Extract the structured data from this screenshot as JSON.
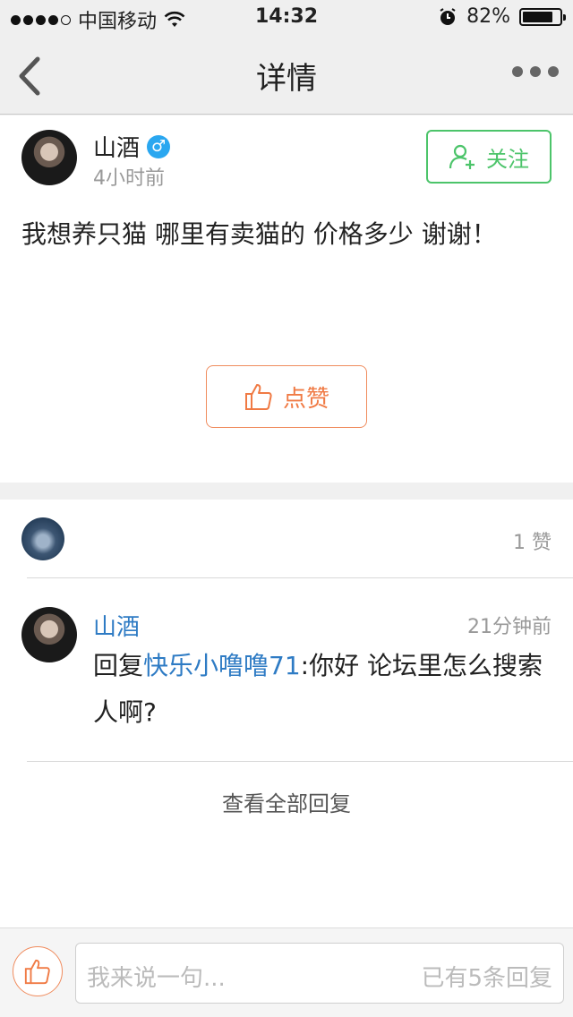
{
  "status_bar": {
    "carrier": "中国移动",
    "time": "14:32",
    "battery": "82%",
    "battery_level": 0.82,
    "signal_bars": 4
  },
  "nav": {
    "title": "详情",
    "back_icon": "chevron-left-icon",
    "more_icon": "more-dots-icon"
  },
  "post": {
    "author": "山酒",
    "gender_symbol": "♂",
    "time": "4小时前",
    "follow_label": "关注",
    "content": "我想养只猫  哪里有卖猫的  价格多少 谢谢！",
    "like_label": "点赞"
  },
  "likes": {
    "count": "1 赞"
  },
  "reply": {
    "author": "山酒",
    "time": "21分钟前",
    "prefix": "回复",
    "mention": "快乐小噜噜71",
    "text": ":你好  论坛里怎么搜索人啊?"
  },
  "view_all_label": "查看全部回复",
  "bottom_bar": {
    "input_placeholder": "我来说一句...",
    "reply_count": "已有5条回复"
  },
  "colors": {
    "accent_green": "#4cc46a",
    "accent_orange": "#f07a44",
    "link_blue": "#2e7bc4",
    "gender_blue": "#2aa7f0"
  }
}
